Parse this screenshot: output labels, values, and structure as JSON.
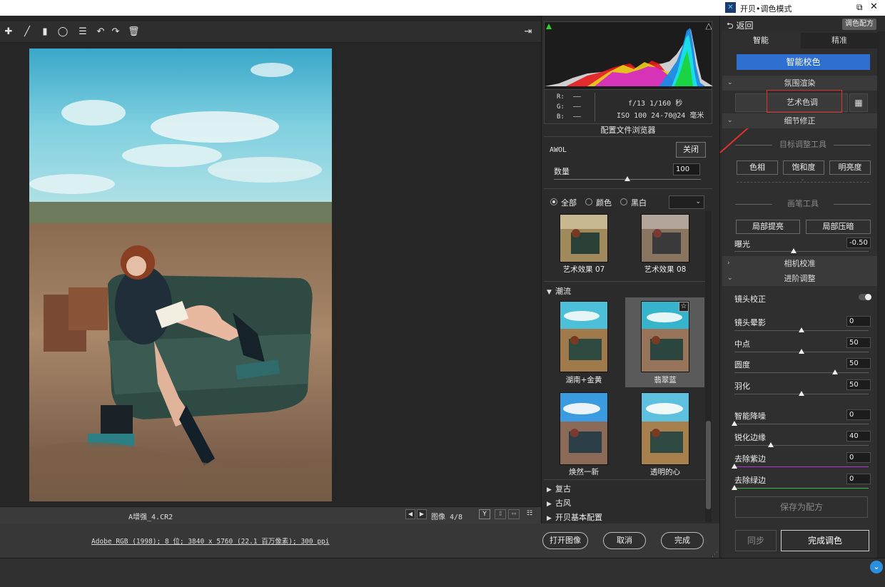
{
  "window": {
    "right_title": "开贝•调色模式",
    "right_controls": [
      "⧉",
      "✕"
    ]
  },
  "toolbar": {
    "icons": [
      "add-point-icon",
      "brush-icon",
      "gradient-icon",
      "radial-icon",
      "list-icon",
      "undo-icon",
      "redo-icon",
      "trash-icon"
    ],
    "export_icon": "export-icon"
  },
  "editor": {
    "filename": "A增强_4.CR2",
    "image_counter": "图像 4/8",
    "file_info": "Adobe RGB (1998); 8 位; 3840 x 5760 (22.1 百万像素); 300 ppi"
  },
  "bottom_buttons": {
    "open": "打开图像",
    "cancel": "取消",
    "done": "完成"
  },
  "histogram": {
    "r_label": "R:",
    "g_label": "G:",
    "b_label": "B:",
    "r_val": "——",
    "g_val": "——",
    "b_val": "——",
    "camera_line1": "f/13   1/160 秒",
    "camera_line2": "ISO 100   24-70@24 毫米"
  },
  "profile_browser": {
    "title": "配置文件浏览器",
    "profile_name": "AWOL",
    "close": "关闭",
    "amount_label": "数量",
    "amount_value": "100",
    "amount": 0.5,
    "filter_all": "全部",
    "filter_color": "颜色",
    "filter_bw": "黑白",
    "filter_dropdown": "⌄",
    "items": [
      {
        "label": "艺术效果 07"
      },
      {
        "label": "艺术效果 08"
      },
      {
        "label": "湖南+金黄"
      },
      {
        "label": "翡翠蓝"
      },
      {
        "label": "焕然一新"
      },
      {
        "label": "透明的心"
      }
    ],
    "group_trend": "潮流",
    "group_retro": "复古",
    "group_ancient": "古风",
    "group_basic": "开贝基本配置"
  },
  "right_panel": {
    "back": "返回",
    "preset": "调色配方",
    "tab_smart": "智能",
    "tab_precise": "精准",
    "smart_correct": "智能校色",
    "atmosphere": "氛围渲染",
    "art_tone": "艺术色调",
    "detail": "细节修正",
    "target_tool": "目标调整工具",
    "hue": "色相",
    "saturation": "饱和度",
    "brightness": "明亮度",
    "brush_tool": "画笔工具",
    "local_bright": "局部提亮",
    "local_dark": "局部压暗",
    "exposure_label": "曝光",
    "exposure_value": "-0.50",
    "exposure": 0.44,
    "camera_calib": "相机校准",
    "advanced": "进阶调整",
    "lens_correct": "镜头校正",
    "vignette_label": "镜头晕影",
    "vignette_value": "0",
    "vignette": 0.5,
    "midpoint_label": "中点",
    "midpoint_value": "50",
    "midpoint": 0.5,
    "roundness_label": "圆度",
    "roundness_value": "50",
    "roundness": 0.75,
    "feather_label": "羽化",
    "feather_value": "50",
    "feather": 0.5,
    "denoise_label": "智能降噪",
    "denoise_value": "0",
    "denoise": 0.0,
    "sharpen_label": "锐化边缘",
    "sharpen_value": "40",
    "sharpen": 0.27,
    "purple_label": "去除紫边",
    "purple_value": "0",
    "purple": 0.0,
    "green_label": "去除绿边",
    "green_value": "0",
    "green": 0.0,
    "save_preset": "保存为配方",
    "sync": "同步",
    "finish": "完成调色"
  },
  "colors": {
    "accent": "#2f6fd0",
    "highlight_box": "#e0322e",
    "purple_track": "#b03ad0",
    "green_track": "#3ab84a"
  }
}
